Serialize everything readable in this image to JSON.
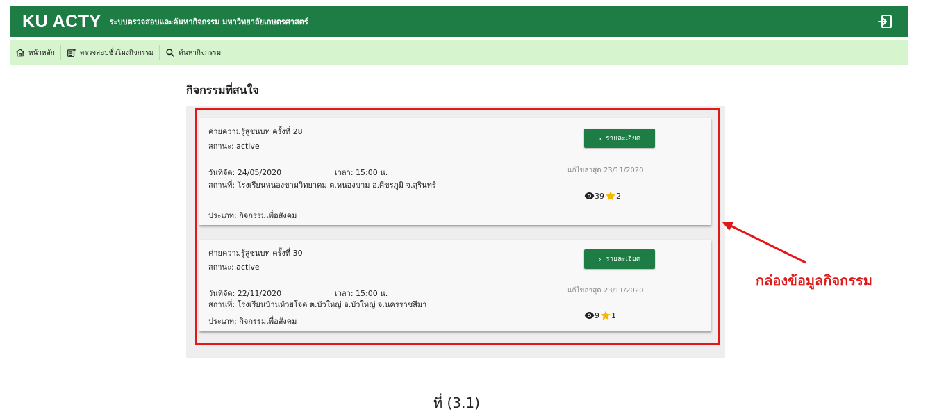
{
  "header": {
    "brand": "KU ACTY",
    "subtitle": "ระบบตรวจสอบและค้นหากิจกรรม มหาวิทยาลัยเกษตรศาสตร์"
  },
  "nav": {
    "items": [
      {
        "label": "หน้าหลัก",
        "icon": "home-icon"
      },
      {
        "label": "ตรวจสอบชั่วโมงกิจกรรม",
        "icon": "checklist-icon"
      },
      {
        "label": "ค้นหากิจกรรม",
        "icon": "search-icon"
      }
    ]
  },
  "page": {
    "heading": "กิจกรรมที่สนใจ"
  },
  "activities": [
    {
      "title": "ค่ายความรู้สู่ชนบท ครั้งที่ 28",
      "status": "สถานะ: active",
      "date": "วันที่จัด: 24/05/2020",
      "time": "เวลา: 15:00 น.",
      "place": "สถานที่: โรงเรียนหนองขามวิทยาคม ต.หนองขาม อ.ศีขรภูมิ จ.สุรินทร์",
      "type": "ประเภท: กิจกรรมเพื่อสังคม",
      "detail_label": "รายละเอียด",
      "updated": "แก้ไขล่าสุด 23/11/2020",
      "views": "39",
      "stars": "2"
    },
    {
      "title": "ค่ายความรู้สู่ชนบท ครั้งที่ 30",
      "status": "สถานะ: active",
      "date": "วันที่จัด: 22/11/2020",
      "time": "เวลา: 15:00 น.",
      "place": "สถานที่: โรงเรียนบ้านห้วยโจด ต.บัวใหญ่ อ.บัวใหญ่ จ.นครราชสีมา",
      "type": "ประเภท: กิจกรรมเพื่อสังคม",
      "detail_label": "รายละเอียด",
      "updated": "แก้ไขล่าสุด 23/11/2020",
      "views": "9",
      "stars": "1"
    }
  ],
  "annotation": {
    "label": "กล่องข้อมูลกิจกรรม",
    "color": "#e01818"
  },
  "caption": "ที่ (3.1)",
  "colors": {
    "primary": "#1e7d45",
    "nav_bg": "#d6f5cf",
    "star": "#f5b800"
  }
}
